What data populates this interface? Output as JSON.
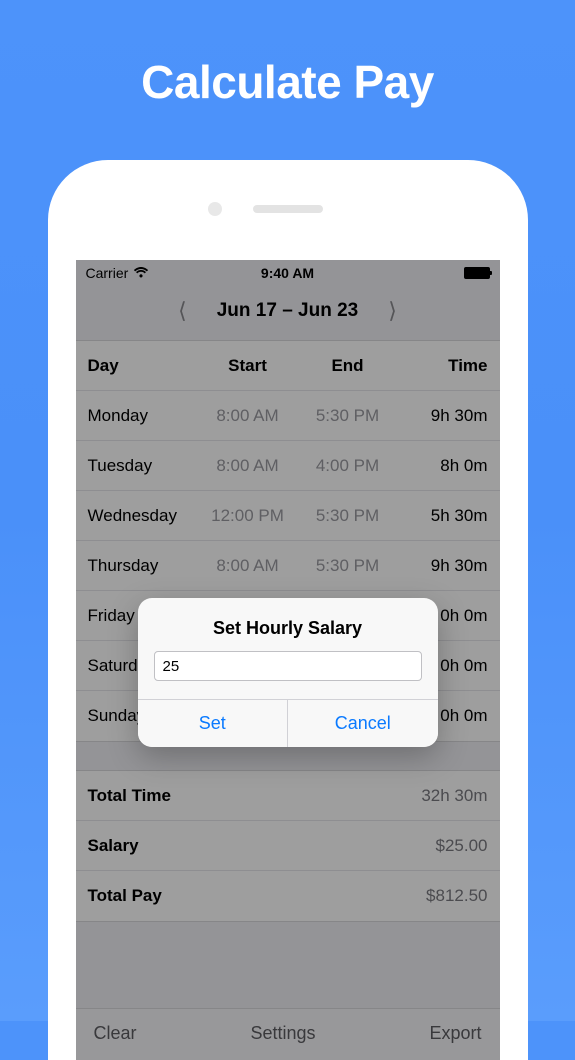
{
  "hero": {
    "title": "Calculate Pay"
  },
  "status": {
    "carrier": "Carrier",
    "time": "9:40 AM"
  },
  "week": {
    "label": "Jun 17 – Jun 23"
  },
  "headers": {
    "day": "Day",
    "start": "Start",
    "end": "End",
    "time": "Time"
  },
  "rows": [
    {
      "day": "Monday",
      "start": "8:00 AM",
      "end": "5:30 PM",
      "time": "9h 30m"
    },
    {
      "day": "Tuesday",
      "start": "8:00 AM",
      "end": "4:00 PM",
      "time": "8h 0m"
    },
    {
      "day": "Wednesday",
      "start": "12:00 PM",
      "end": "5:30 PM",
      "time": "5h 30m"
    },
    {
      "day": "Thursday",
      "start": "8:00 AM",
      "end": "5:30 PM",
      "time": "9h 30m"
    },
    {
      "day": "Friday",
      "start": "",
      "end": "",
      "time": "0h 0m"
    },
    {
      "day": "Saturday",
      "start": "",
      "end": "",
      "time": "0h 0m"
    },
    {
      "day": "Sunday",
      "start": "",
      "end": "",
      "time": "0h 0m"
    }
  ],
  "summary": {
    "total_time_label": "Total Time",
    "total_time": "32h 30m",
    "salary_label": "Salary",
    "salary": "$25.00",
    "total_pay_label": "Total Pay",
    "total_pay": "$812.50"
  },
  "toolbar": {
    "clear": "Clear",
    "settings": "Settings",
    "export": "Export"
  },
  "alert": {
    "title": "Set Hourly Salary",
    "value": "25",
    "set": "Set",
    "cancel": "Cancel"
  }
}
